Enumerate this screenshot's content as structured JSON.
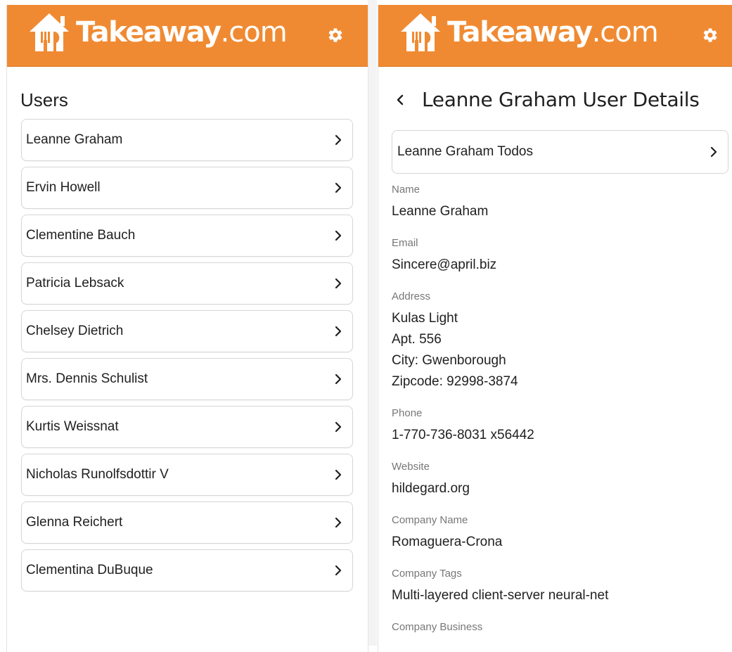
{
  "brand": {
    "name": "Takeaway",
    "suffix": ".com",
    "color": "#f08a32"
  },
  "list_screen": {
    "title": "Users",
    "users": [
      {
        "label": "Leanne Graham"
      },
      {
        "label": "Ervin Howell"
      },
      {
        "label": "Clementine Bauch"
      },
      {
        "label": "Patricia Lebsack"
      },
      {
        "label": "Chelsey Dietrich"
      },
      {
        "label": "Mrs. Dennis Schulist"
      },
      {
        "label": "Kurtis Weissnat"
      },
      {
        "label": "Nicholas Runolfsdottir V"
      },
      {
        "label": "Glenna Reichert"
      },
      {
        "label": "Clementina DuBuque"
      }
    ]
  },
  "detail_screen": {
    "title": "Leanne Graham User Details",
    "todos_label": "Leanne Graham Todos",
    "fields": [
      {
        "label": "Name",
        "value": "Leanne Graham"
      },
      {
        "label": "Email",
        "value": "Sincere@april.biz"
      },
      {
        "label": "Address",
        "lines": [
          "Kulas Light",
          "Apt. 556",
          "City: Gwenborough",
          "Zipcode: 92998-3874"
        ]
      },
      {
        "label": "Phone",
        "value": "1-770-736-8031 x56442"
      },
      {
        "label": "Website",
        "value": "hildegard.org"
      },
      {
        "label": "Company Name",
        "value": "Romaguera-Crona"
      },
      {
        "label": "Company Tags",
        "value": "Multi-layered client-server neural-net"
      },
      {
        "label": "Company Business",
        "value": ""
      }
    ]
  },
  "icons": {
    "logo": "takeaway-house-logo-icon",
    "settings": "gear-icon",
    "row": "chevron-right-icon",
    "back": "chevron-left-icon"
  }
}
